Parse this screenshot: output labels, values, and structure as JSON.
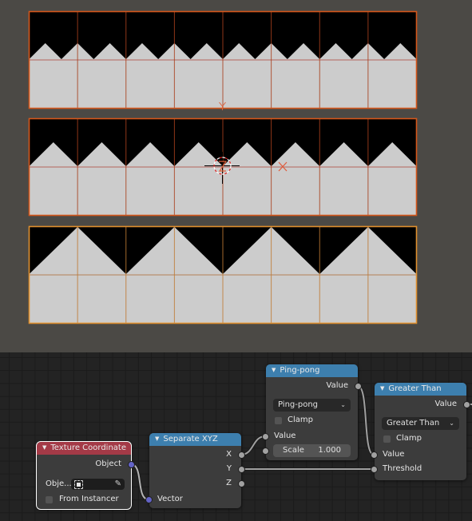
{
  "viewport": {
    "background": "#4b4945",
    "planes": [
      {
        "name": "plane-top",
        "pattern": "triangle-small",
        "outline": "#d4561a",
        "selected": true,
        "active": false
      },
      {
        "name": "plane-middle",
        "pattern": "triangle-medium",
        "outline": "#d4561a",
        "selected": true,
        "active": false
      },
      {
        "name": "plane-bottom",
        "pattern": "triangle-large",
        "outline": "#e0902e",
        "selected": true,
        "active": true
      }
    ],
    "subdivisions": 8,
    "colors": {
      "dark": "#000000",
      "light": "#cccccc",
      "wire": "#b8562e"
    }
  },
  "node_editor": {
    "nodes": {
      "texture_coordinate": {
        "title": "Texture Coordinate",
        "header_color": "#a43a47",
        "outputs": [
          "Object"
        ],
        "object_label": "Obje...",
        "from_instancer_label": "From Instancer",
        "from_instancer_checked": false
      },
      "separate_xyz": {
        "title": "Separate XYZ",
        "header_color": "#3d7fae",
        "outputs": [
          "X",
          "Y",
          "Z"
        ],
        "inputs": [
          "Vector"
        ]
      },
      "ping_pong": {
        "title": "Ping-pong",
        "header_color": "#3d7fae",
        "output": "Value",
        "operation": "Ping-pong",
        "clamp_label": "Clamp",
        "clamp_checked": false,
        "input_value": "Value",
        "scale_label": "Scale",
        "scale_value": "1.000"
      },
      "greater_than": {
        "title": "Greater Than",
        "header_color": "#3d7fae",
        "output": "Value",
        "operation": "Greater Than",
        "clamp_label": "Clamp",
        "clamp_checked": false,
        "input_value": "Value",
        "input_threshold": "Threshold"
      }
    },
    "links": [
      {
        "from": "Texture Coordinate.Object",
        "to": "Separate XYZ.Vector"
      },
      {
        "from": "Separate XYZ.X",
        "to": "Ping-pong.Value"
      },
      {
        "from": "Separate XYZ.Y",
        "to": "Greater Than.Threshold"
      },
      {
        "from": "Ping-pong.Value",
        "to": "Greater Than.Value"
      }
    ]
  }
}
